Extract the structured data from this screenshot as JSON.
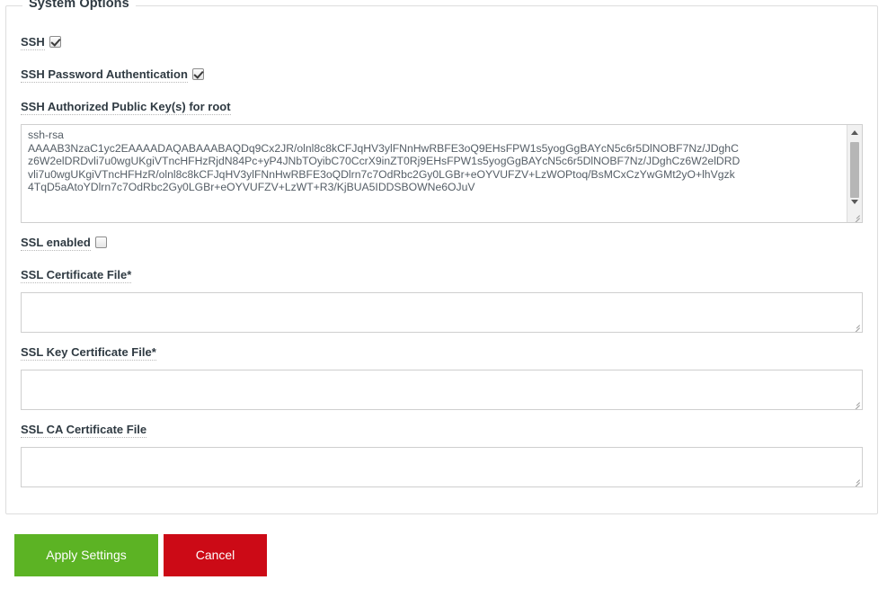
{
  "fieldset": {
    "legend": "System Options"
  },
  "fields": {
    "ssh": {
      "label": "SSH",
      "checked": true
    },
    "ssh_password_auth": {
      "label": "SSH Password Authentication",
      "checked": true
    },
    "ssh_authorized_keys": {
      "label": "SSH Authorized Public Key(s) for root",
      "value": "ssh-rsa\nAAAAB3NzaC1yc2EAAAADAQABAAABAQDq9Cx2JR/olnl8c8kCFJqHV3ylFNnHwRBFE3oQ9EHsFPW1s5yogGgBAYcN5c6r5DlNOBF7Nz/JDghC\nz6W2elDRDvli7u0wgUKgiVTncHFHzRjdN84Pc+yP4JNbTOyibC70CcrX9inZT0Rj9EHsFPW1s5yogGgBAYcN5c6r5DlNOBF7Nz/JDghCz6W2elDRD\nvli7u0wgUKgiVTncHFHzR/olnl8c8kCFJqHV3ylFNnHwRBFE3oQDlrn7c7OdRbc2Gy0LGBr+eOYVUFZV+LzWOPtoq/BsMCxCzYwGMt2yO+lhVgzk\n4TqD5aAtoYDlrn7c7OdRbc2Gy0LGBr+eOYVUFZV+LzWT+R3/KjBUA5IDDSBOWNe6OJuV"
    },
    "ssl_enabled": {
      "label": "SSL enabled",
      "checked": false
    },
    "ssl_certificate_file": {
      "label": "SSL Certificate File*",
      "value": ""
    },
    "ssl_key_certificate_file": {
      "label": "SSL Key Certificate File*",
      "value": ""
    },
    "ssl_ca_certificate_file": {
      "label": "SSL CA Certificate File",
      "value": ""
    }
  },
  "buttons": {
    "apply": "Apply Settings",
    "cancel": "Cancel"
  },
  "colors": {
    "apply_green": "#5cb324",
    "cancel_red": "#cc0a16",
    "label_text": "#2f3a42",
    "border": "#dddddd"
  }
}
